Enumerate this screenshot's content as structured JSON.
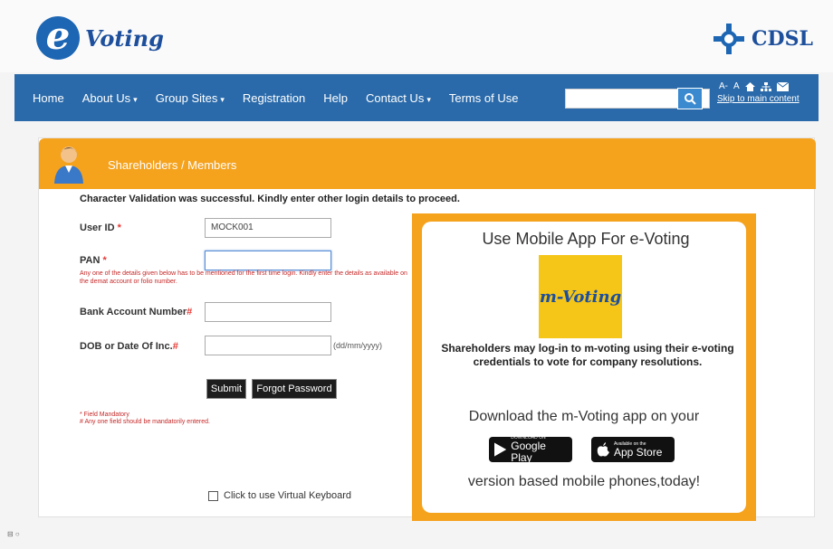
{
  "header": {
    "logo_letter": "e",
    "logo_text": "Voting",
    "cdsl_text": "CDSL"
  },
  "nav": {
    "items": [
      {
        "label": "Home",
        "has_caret": false
      },
      {
        "label": "About Us",
        "has_caret": true
      },
      {
        "label": "Group Sites",
        "has_caret": true
      },
      {
        "label": "Registration",
        "has_caret": false
      },
      {
        "label": "Help",
        "has_caret": false
      },
      {
        "label": "Contact Us",
        "has_caret": true
      },
      {
        "label": "Terms of Use",
        "has_caret": false
      }
    ],
    "search_value": "",
    "font_small": "A-",
    "font_normal": "A",
    "skip_link": "Skip to main content"
  },
  "panel": {
    "title": "Shareholders / Members",
    "message": "Character Validation was successful. Kindly enter other login details to proceed.",
    "user_id_label": "User ID",
    "user_id_value": "MOCK001",
    "pan_label": "PAN",
    "pan_value": "",
    "pan_hint": "Any one of the details given below has to be mentioned for the first time login. Kindly enter the details as available on the demat account or folio number.",
    "bank_label": "Bank Account Number",
    "bank_value": "",
    "dob_label": "DOB or Date Of Inc.",
    "dob_value": "",
    "dob_format": "(dd/mm/yyyy)",
    "submit_label": "Submit",
    "forgot_label": "Forgot Password",
    "note_mandatory": "* Field Mandatory",
    "note_any_one": "# Any one field should be mandatorily entered.",
    "virtual_keyboard": "Click to use Virtual Keyboard"
  },
  "app_box": {
    "title": "Use Mobile App For e-Voting",
    "logo_text": "m-Voting",
    "description": "Shareholders may log-in to m-voting using their e-voting credentials to vote for company resolutions.",
    "download_text": "Download the m-Voting app on your",
    "google_small": "DOWNLOAD ON",
    "google_label": "Google Play",
    "apple_small": "Available on the",
    "apple_label": "App Store",
    "version_text": "version based mobile phones,today!"
  },
  "colors": {
    "nav_blue": "#2a6aaa",
    "orange": "#f5a21d",
    "logo_blue": "#1d66b4"
  }
}
